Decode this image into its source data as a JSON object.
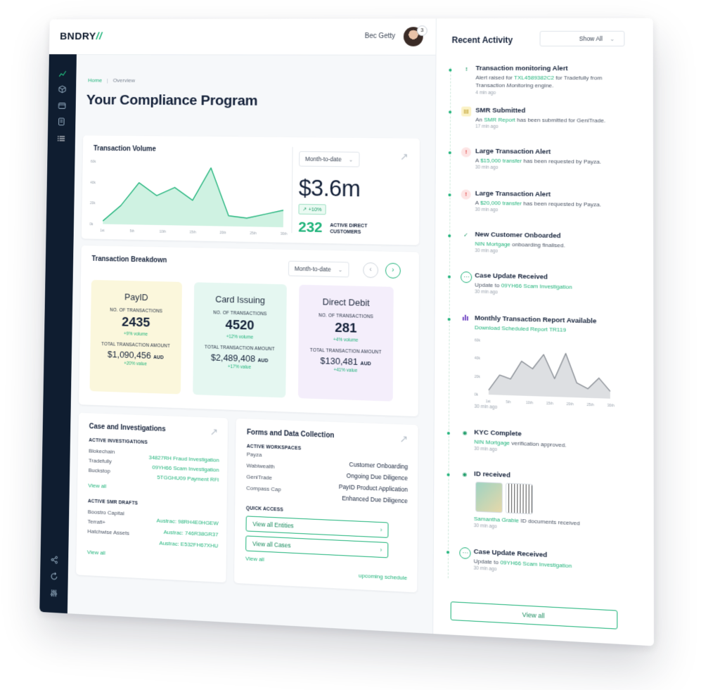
{
  "header": {
    "logo_text": "BNDRY",
    "logo_slash": "//",
    "user_name": "Bec Getty",
    "notification_count": "3"
  },
  "breadcrumb": {
    "home": "Home",
    "separator": "|",
    "current": "Overview"
  },
  "page_title": "Your Compliance Program",
  "volume": {
    "title": "Transaction Volume",
    "period": "Month-to-date",
    "amount": "$3.6m",
    "growth": "+10%",
    "active_count": "232",
    "active_label": "ACTIVE DIRECT CUSTOMERS"
  },
  "chart_data": {
    "type": "area",
    "title": "Transaction Volume",
    "x": [
      "1st",
      "5th",
      "10th",
      "15th",
      "20th",
      "25th",
      "30th"
    ],
    "y_ticks": [
      "0k",
      "20k",
      "40k",
      "60k"
    ],
    "values": [
      3,
      18,
      40,
      28,
      36,
      24,
      55,
      10,
      8,
      12,
      16
    ],
    "ylim": [
      0,
      60
    ],
    "grid": false,
    "colors": {
      "line": "#1fb37a",
      "fill": "#bfeed8"
    }
  },
  "breakdown": {
    "title": "Transaction Breakdown",
    "period": "Month-to-date",
    "tiles": [
      {
        "name": "PayID",
        "count_label": "NO. OF TRANSACTIONS",
        "count": "2435",
        "count_delta": "+9% volume",
        "amount_label": "TOTAL TRANSACTION AMOUNT",
        "amount": "$1,090,456",
        "currency": "AUD",
        "amount_delta": "+20% value",
        "bg": "#fbf7dc"
      },
      {
        "name": "Card Issuing",
        "count_label": "NO. OF TRANSACTIONS",
        "count": "4520",
        "count_delta": "+12% volume",
        "amount_label": "TOTAL TRANSACTION AMOUNT",
        "amount": "$2,489,408",
        "currency": "AUD",
        "amount_delta": "+17% value",
        "bg": "#e5f7f1"
      },
      {
        "name": "Direct Debit",
        "count_label": "NO. OF TRANSACTIONS",
        "count": "281",
        "count_delta": "+4% volume",
        "amount_label": "TOTAL TRANSACTION AMOUNT",
        "amount": "$130,481",
        "currency": "AUD",
        "amount_delta": "+41% value",
        "bg": "#f4eefb"
      }
    ]
  },
  "cases": {
    "title": "Case and Investigations",
    "active_label": "ACTIVE INVESTIGATIONS",
    "investigations": [
      {
        "entity": "Blokechain",
        "case": "34827RH Fraud Investigation"
      },
      {
        "entity": "Tradefully",
        "case": "09YH66 Scam Investigation"
      },
      {
        "entity": "Buckstop",
        "case": "5TGGHU09 Payment RFI"
      }
    ],
    "view_all_1": "View all",
    "smr_label": "ACTIVE SMR DRAFTS",
    "smr": [
      {
        "entity": "Boostro Capital",
        "ref": "Austrac: 98RH4E0HGEW"
      },
      {
        "entity": "Terrafi+",
        "ref": "Austrac: 746R38GR37"
      },
      {
        "entity": "Hatchwise Assets",
        "ref": "Austrac: E532FH67XHU"
      }
    ],
    "view_all_2": "View all"
  },
  "forms": {
    "title": "Forms and Data Collection",
    "active_label": "ACTIVE WORKSPACES",
    "workspaces": [
      {
        "entity": "Payza",
        "form": "Customer Onboarding"
      },
      {
        "entity": "Wabiwealth",
        "form": "Ongoing Due Diligence"
      },
      {
        "entity": "GeniTrade",
        "form": "PayID Product Application"
      },
      {
        "entity": "Compass Cap",
        "form": "Enhanced Due Diligence"
      }
    ],
    "quick_label": "QUICK ACCESS",
    "quick_1": "View all Entities",
    "quick_2": "View all Cases",
    "view_all": "View all",
    "schedule": "upcoming schedule"
  },
  "activity": {
    "title": "Recent Activity",
    "filter": "Show All",
    "items": [
      {
        "title": "Transaction monitoring Alert",
        "pre": "Alert raised for ",
        "link": "TXL4589382C2",
        "post": " for Tradefully from Transaction Monitoring engine.",
        "time": "4 min ago"
      },
      {
        "title": "SMR Submitted",
        "pre": "An ",
        "link": "SMR Report",
        "post": " has been submitted for GeniTrade.",
        "time": "17 min ago"
      },
      {
        "title": "Large Transaction Alert",
        "pre": "A ",
        "link": "$15,000 transfer",
        "post": " has been requested by Payza.",
        "time": "30 min ago"
      },
      {
        "title": "Large Transaction Alert",
        "pre": "A ",
        "link": "$20,000 transfer",
        "post": " has been requested by Payza.",
        "time": "30 min ago"
      },
      {
        "title": "New Customer Onboarded",
        "pre": "",
        "link": "NIN Mortgage",
        "post": " onboarding finalised.",
        "time": "30 min ago"
      },
      {
        "title": "Case Update Received",
        "pre": "Update to ",
        "link": "09YH66 Scam Investigation",
        "post": "",
        "time": "30 min ago"
      },
      {
        "title": "Monthly Transaction Report Available",
        "pre": "",
        "link": "Download Scheduled Report TR119",
        "post": "",
        "time": "30 min ago"
      },
      {
        "title": "KYC Complete",
        "pre": "",
        "link": "NIN Mortgage",
        "post": " verification approved.",
        "time": "30 min ago"
      },
      {
        "title": "ID received",
        "pre": "",
        "link": "Samantha Grable",
        "post": " ID documents received",
        "time": "30 min ago"
      },
      {
        "title": "Case Update Received",
        "pre": "Update to ",
        "link": "09YH66 Scam Investigation",
        "post": "",
        "time": "30 min ago"
      }
    ],
    "mini_chart": {
      "y_ticks": [
        "0k",
        "20k",
        "40k",
        "60k"
      ],
      "x": [
        "1st",
        "5th",
        "10th",
        "15th",
        "20th",
        "25th",
        "30th"
      ],
      "values": [
        5,
        22,
        18,
        38,
        30,
        46,
        20,
        48,
        16,
        10,
        22,
        8
      ]
    },
    "view_all": "View all"
  },
  "icons": {
    "sidebar_top": [
      "chart-line-icon",
      "cube-icon",
      "wallet-icon",
      "documents-icon",
      "list-icon"
    ],
    "sidebar_bottom": [
      "share-icon",
      "refresh-icon",
      "sliders-icon"
    ]
  }
}
